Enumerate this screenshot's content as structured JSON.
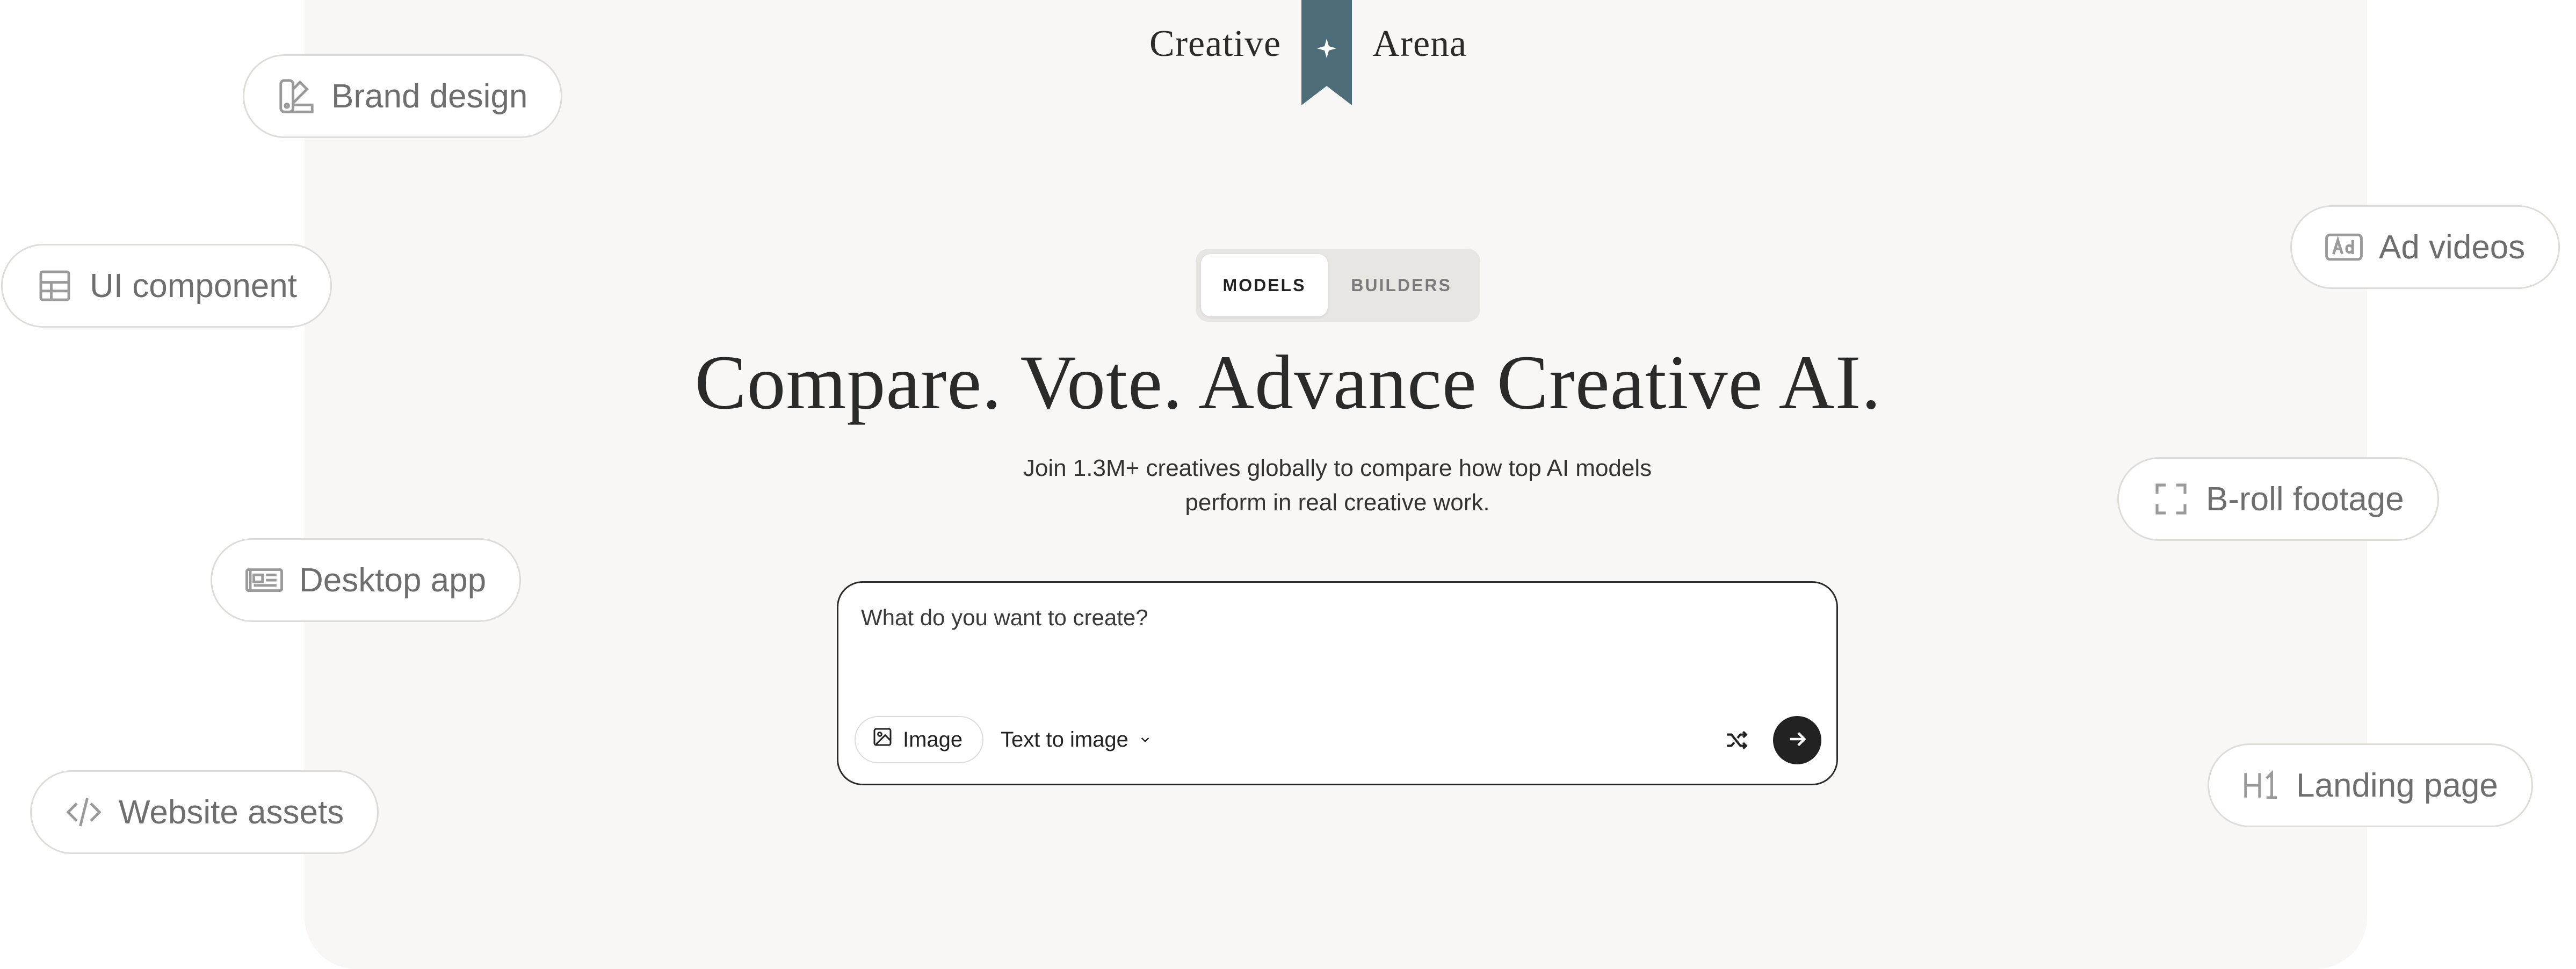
{
  "brand": {
    "left_word": "Creative",
    "right_word": "Arena",
    "accent_color": "#4d6e79"
  },
  "toggle": {
    "models_label": "MODELS",
    "builders_label": "BUILDERS",
    "active": "MODELS"
  },
  "hero": {
    "headline": "Compare. Vote. Advance Creative AI.",
    "subline_line1": "Join 1.3M+ creatives globally to compare how top AI models",
    "subline_line2": "perform in real creative work."
  },
  "prompt": {
    "placeholder": "What do you want to create?",
    "image_chip_label": "Image",
    "mode_label": "Text to image",
    "icons": {
      "image": "image-icon",
      "mode_dropdown": "chevron-down-icon",
      "shuffle": "shuffle-icon",
      "submit": "arrow-right-icon"
    }
  },
  "floating_pills": [
    {
      "label": "Brand design",
      "icon": "palette-icon"
    },
    {
      "label": "UI component",
      "icon": "grid-icon"
    },
    {
      "label": "Desktop app",
      "icon": "window-icon"
    },
    {
      "label": "Website assets",
      "icon": "code-icon"
    },
    {
      "label": "Ad videos",
      "icon": "ad-icon"
    },
    {
      "label": "B-roll footage",
      "icon": "frame-icon"
    },
    {
      "label": "Landing page",
      "icon": "heading-icon"
    }
  ]
}
